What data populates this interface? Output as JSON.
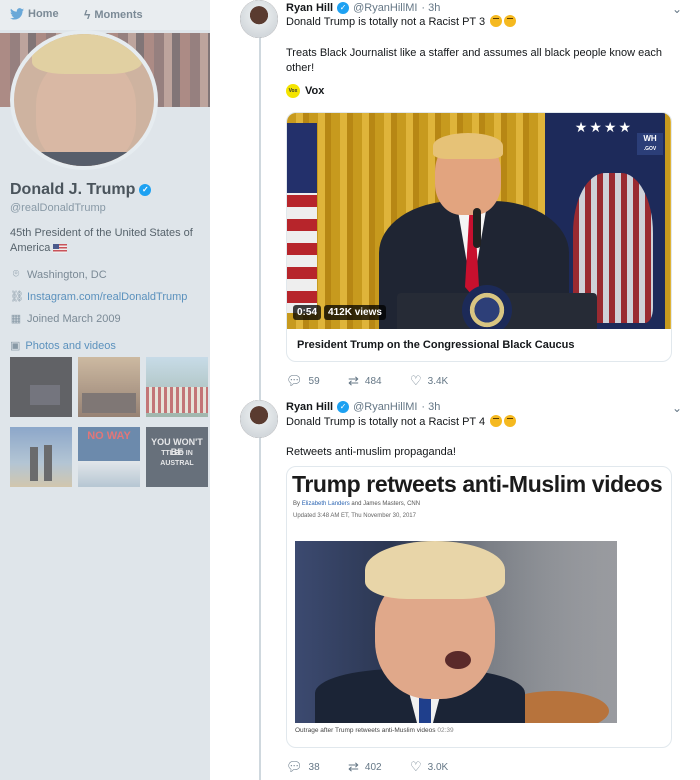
{
  "nav": {
    "home": "Home",
    "moments": "Moments"
  },
  "profile": {
    "name": "Donald J. Trump",
    "handle": "@realDonaldTrump",
    "bio": "45th President of the United States of America",
    "location": "Washington, DC",
    "link": "Instagram.com/realDonaldTrump",
    "joined": "Joined March 2009",
    "photos_link": "Photos and videos",
    "thumb_texts": [
      "NO WAY",
      "YOU WON'T BE",
      "TTLED IN AUSTRAL"
    ]
  },
  "tweets": [
    {
      "name": "Ryan Hill",
      "handle": "@RyanHillMI",
      "time": "· 3h",
      "text": "Donald Trump is totally not a Racist PT 3",
      "body": "Treats Black Journalist like a staffer and assumes all black people know each other!",
      "source": "Vox",
      "source_logo": "Vox",
      "card": {
        "duration": "0:54",
        "views": "412K views",
        "title": "President Trump on the Congressional Black Caucus",
        "wh_logo": "WH",
        "wh_sub": ".GOV"
      },
      "replies": "59",
      "retweets": "484",
      "likes": "3.4K"
    },
    {
      "name": "Ryan Hill",
      "handle": "@RyanHillMI",
      "time": "· 3h",
      "text": "Donald Trump is totally not a Racist PT 4",
      "body": "Retweets anti-muslim propaganda!",
      "card": {
        "headline": "Trump retweets anti-Muslim videos",
        "byline_by": "By",
        "byline_author": "Elizabeth Landers",
        "byline_rest": "and James Masters, CNN",
        "updated": "Updated 3:48 AM ET, Thu November 30, 2017",
        "caption": "Outrage after Trump retweets anti-Muslim videos",
        "caption_time": "02:39"
      },
      "replies": "38",
      "retweets": "402",
      "likes": "3.0K"
    }
  ],
  "colors": {
    "accent": "#1da1f2",
    "dim_bg": "#dfe5ea"
  }
}
